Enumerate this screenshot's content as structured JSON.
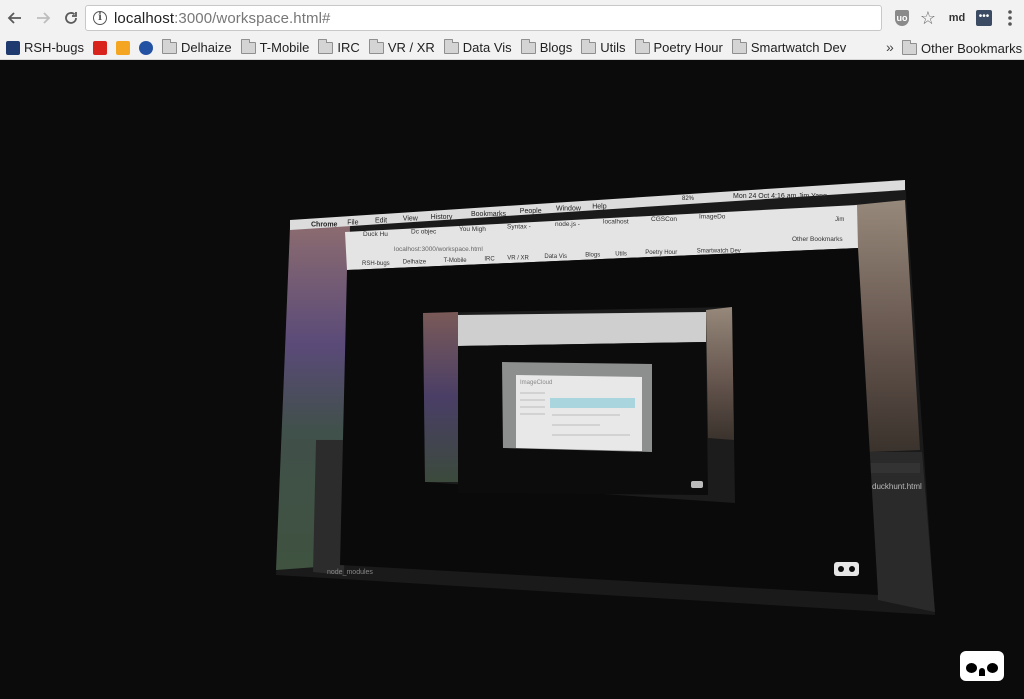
{
  "browser": {
    "url_host": "localhost",
    "url_path": ":3000/workspace.html#",
    "extensions": {
      "ublock_label": "uo",
      "md_label": "md",
      "square_label": "•••"
    }
  },
  "bookmarks": [
    {
      "label": "RSH-bugs",
      "icon": "rsh-icon"
    },
    {
      "label": "",
      "icon": "m-icon"
    },
    {
      "label": "",
      "icon": "box-icon"
    },
    {
      "label": "",
      "icon": "globe-icon"
    },
    {
      "label": "Delhaize",
      "icon": "folder-icon"
    },
    {
      "label": "T-Mobile",
      "icon": "folder-icon"
    },
    {
      "label": "IRC",
      "icon": "folder-icon"
    },
    {
      "label": "VR / XR",
      "icon": "folder-icon"
    },
    {
      "label": "Data Vis",
      "icon": "folder-icon"
    },
    {
      "label": "Blogs",
      "icon": "folder-icon"
    },
    {
      "label": "Utils",
      "icon": "folder-icon"
    },
    {
      "label": "Poetry Hour",
      "icon": "folder-icon"
    },
    {
      "label": "Smartwatch Dev",
      "icon": "folder-icon"
    }
  ],
  "bookmarks_overflow": "»",
  "other_bookmarks": "Other Bookmarks",
  "scene": {
    "mac_menubar": [
      "Chrome",
      "File",
      "Edit",
      "View",
      "History",
      "Bookmarks",
      "People",
      "Window",
      "Help"
    ],
    "mac_status": "Mon 24 Oct  4:16 am    Jim Yang",
    "battery": "82%",
    "inner_tabs": [
      "Duck Hu",
      "Dc objec",
      "You Migh",
      "Syntax -",
      "node.js -",
      "localhost",
      "CGSCon",
      "ImageDo"
    ],
    "inner_profile": "Jim",
    "inner_url": "localhost:3000/workspace.html",
    "inner_bookmarks": [
      "RSH-bugs",
      "Delhaize",
      "T-Mobile",
      "IRC",
      "VR / XR",
      "Data Vis",
      "Blogs",
      "Utils",
      "Poetry Hour",
      "Smartwatch Dev"
    ],
    "inner_other_bookmarks": "Other Bookmarks",
    "editor_file": "duckhunt.html",
    "editor_tree_item": "node_modules",
    "deep_title": "ImageCloud"
  },
  "colors": {
    "chrome_bg": "#f2f2f2",
    "viewport_bg": "#0b0b0b"
  }
}
